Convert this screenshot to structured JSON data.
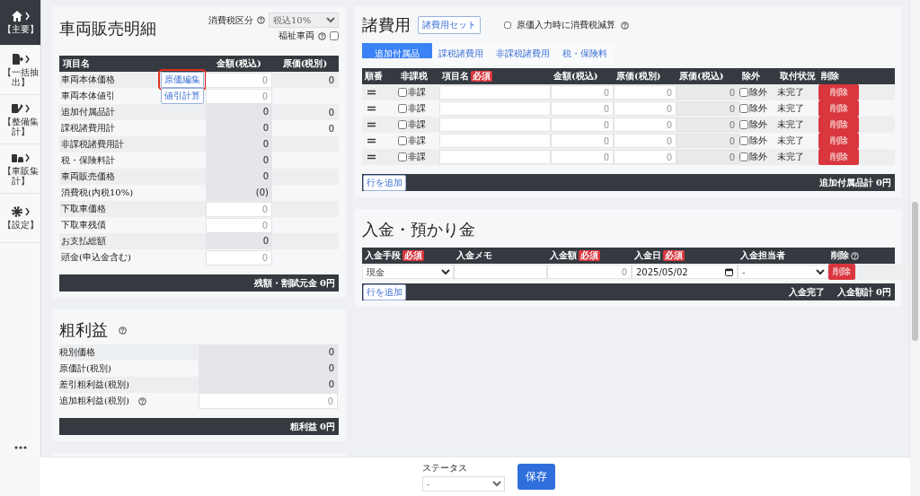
{
  "sidebar": {
    "items": [
      {
        "kind": "home",
        "label": "【主要】",
        "selected": true
      },
      {
        "kind": "export",
        "label": "【一括抽出】",
        "selected": false
      },
      {
        "kind": "tools",
        "label": "【整備集計】",
        "selected": false
      },
      {
        "kind": "car",
        "label": "【車販集計】",
        "selected": false
      },
      {
        "kind": "gear",
        "label": "【設定】",
        "selected": false
      }
    ]
  },
  "sales": {
    "title": "車両販売明細",
    "tax_label": "消費税区分",
    "tax_select": "税込10%",
    "welfare_label": "福祉車両",
    "welfare_checked": false,
    "columns": [
      "項目名",
      "金額(税込)",
      "原価(税別)"
    ],
    "rows": [
      {
        "name": "車両本体価格",
        "kind": "input",
        "placeholder": "0",
        "cost": "0",
        "button": {
          "label": "原価編集",
          "highlighted": true
        }
      },
      {
        "name": "車両本体値引",
        "kind": "input",
        "placeholder": "0",
        "button": {
          "label": "値引計算",
          "highlighted": false
        }
      },
      {
        "name": "追加付属品計",
        "kind": "readonly",
        "amount": "0",
        "cost": "0"
      },
      {
        "name": "課税諸費用計",
        "kind": "readonly",
        "amount": "0",
        "cost": "0"
      },
      {
        "name": "非課税諸費用計",
        "kind": "readonly",
        "amount": "0"
      },
      {
        "name": "税・保険料計",
        "kind": "readonly",
        "amount": "0"
      },
      {
        "name": "車両販売価格",
        "kind": "readonly",
        "amount": "0"
      },
      {
        "name": "消費税(内税10%)",
        "kind": "readonly",
        "amount": "(0)"
      },
      {
        "name": "下取車価格",
        "kind": "input",
        "placeholder": "0"
      },
      {
        "name": "下取車残債",
        "kind": "input",
        "placeholder": "0"
      },
      {
        "name": "お支払総額",
        "kind": "readonly",
        "amount": "0"
      },
      {
        "name": "頭金(申込金含む)",
        "kind": "input",
        "placeholder": "0"
      }
    ],
    "footer": "残額・割賦元金 0円"
  },
  "profit": {
    "title": "粗利益",
    "rows": [
      {
        "name": "税別価格",
        "kind": "readonly",
        "amount": "0",
        "help": false
      },
      {
        "name": "原価計(税別)",
        "kind": "readonly",
        "amount": "0",
        "help": false
      },
      {
        "name": "差引粗利益(税別)",
        "kind": "readonly",
        "amount": "0",
        "help": false
      },
      {
        "name": "追加粗利益(税別)",
        "kind": "input",
        "placeholder": "0",
        "help": true
      }
    ],
    "footer": "粗利益 0円"
  },
  "fees": {
    "title": "諸費用",
    "set_button": "諸費用セット",
    "tax_option": {
      "label": "原価入力時に消費税減算",
      "checked": false
    },
    "tabs": [
      {
        "label": "追加付属品",
        "selected": true
      },
      {
        "label": "課税諸費用",
        "selected": false
      },
      {
        "label": "非課税諸費用",
        "selected": false
      },
      {
        "label": "税・保険料",
        "selected": false
      }
    ],
    "columns": [
      {
        "label": "順番"
      },
      {
        "label": "非課税"
      },
      {
        "label": "項目名",
        "badge": "必須"
      },
      {
        "label": "金額(税込)"
      },
      {
        "label": "原価(税別)"
      },
      {
        "label": "原価(税込)"
      },
      {
        "label": "除外"
      },
      {
        "label": "取付状況"
      },
      {
        "label": "削除"
      }
    ],
    "rows": [
      {
        "exempt_label": "非課",
        "exempt": false,
        "amount_placeholder": "0",
        "cost_placeholder": "0",
        "cost_tax_placeholder": "0",
        "exclude_label": "除外",
        "exclude": false,
        "status": "未完了",
        "delete": "削除"
      },
      {
        "exempt_label": "非課",
        "exempt": false,
        "amount_placeholder": "0",
        "cost_placeholder": "0",
        "cost_tax_placeholder": "0",
        "exclude_label": "除外",
        "exclude": false,
        "status": "未完了",
        "delete": "削除"
      },
      {
        "exempt_label": "非課",
        "exempt": false,
        "amount_placeholder": "0",
        "cost_placeholder": "0",
        "cost_tax_placeholder": "0",
        "exclude_label": "除外",
        "exclude": false,
        "status": "未完了",
        "delete": "削除"
      },
      {
        "exempt_label": "非課",
        "exempt": false,
        "amount_placeholder": "0",
        "cost_placeholder": "0",
        "cost_tax_placeholder": "0",
        "exclude_label": "除外",
        "exclude": false,
        "status": "未完了",
        "delete": "削除"
      },
      {
        "exempt_label": "非課",
        "exempt": false,
        "amount_placeholder": "0",
        "cost_placeholder": "0",
        "cost_tax_placeholder": "0",
        "exclude_label": "除外",
        "exclude": false,
        "status": "未完了",
        "delete": "削除"
      }
    ],
    "add_button": "行を追加",
    "total": "追加付属品計 0円"
  },
  "payments": {
    "title": "入金・預かり金",
    "columns": [
      {
        "label": "入金手段",
        "badge": "必須",
        "help": false
      },
      {
        "label": "入金メモ",
        "help": false
      },
      {
        "label": "入金額",
        "badge": "必須",
        "help": false
      },
      {
        "label": "入金日",
        "badge": "必須",
        "help": false
      },
      {
        "label": "入金担当者",
        "help": false
      },
      {
        "label": "削除",
        "help": true
      }
    ],
    "rows": [
      {
        "method": "現金",
        "amount_placeholder": "0",
        "date": "2025/05/02",
        "person": "-",
        "delete": "削除"
      }
    ],
    "add_button": "行を追加",
    "status": "入金完了",
    "total": "入金額計 0円"
  },
  "footer": {
    "status_label": "ステータス",
    "status_value": "-",
    "save": "保存"
  }
}
